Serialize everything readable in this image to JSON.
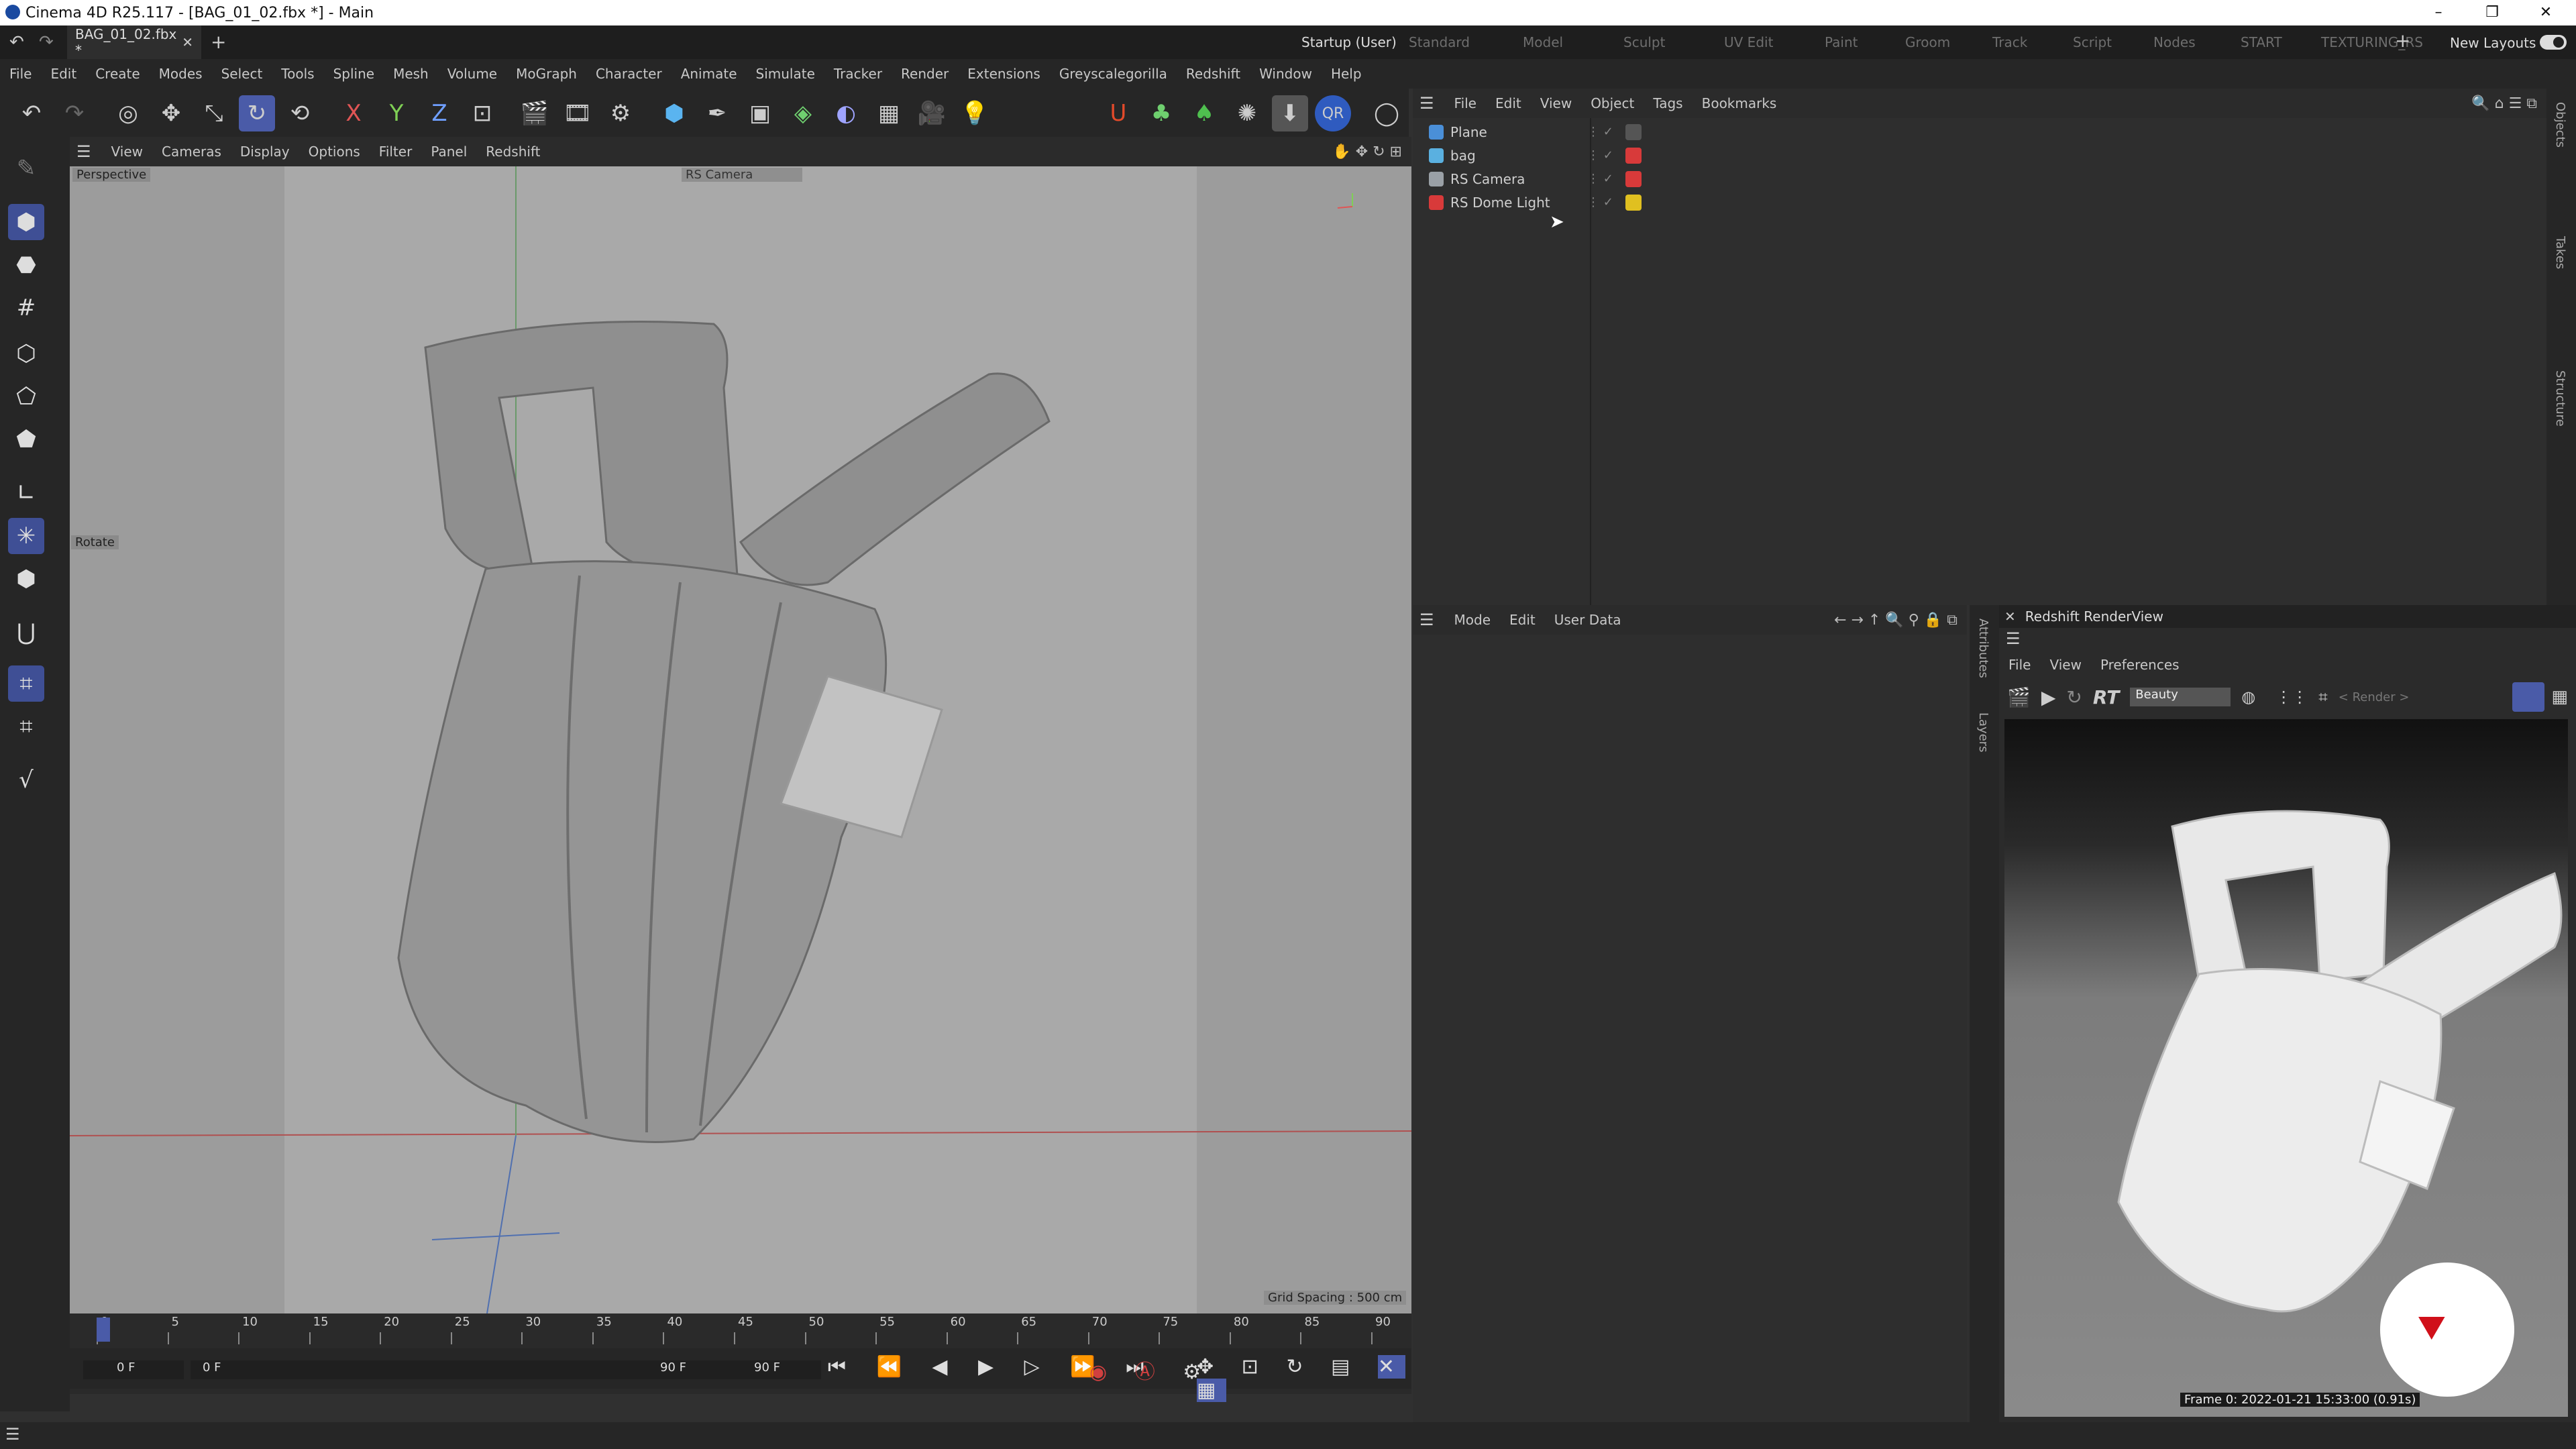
{
  "window": {
    "title": "Cinema 4D R25.117 - [BAG_01_02.fbx *] - Main",
    "min": "–",
    "restore": "❐",
    "close": "✕"
  },
  "tabs": {
    "doc_tab": "BAG_01_02.fbx *",
    "add": "+"
  },
  "layouts": [
    {
      "label": "Startup (User)",
      "active": true
    },
    {
      "label": "Standard"
    },
    {
      "label": "Model"
    },
    {
      "label": "Sculpt"
    },
    {
      "label": "UV Edit"
    },
    {
      "label": "Paint"
    },
    {
      "label": "Groom"
    },
    {
      "label": "Track"
    },
    {
      "label": "Script"
    },
    {
      "label": "Nodes"
    },
    {
      "label": "START"
    },
    {
      "label": "TEXTURING_RS"
    }
  ],
  "layouts_add": "+",
  "new_layouts": "New Layouts",
  "menu": [
    "File",
    "Edit",
    "Create",
    "Modes",
    "Select",
    "Tools",
    "Spline",
    "Mesh",
    "Volume",
    "MoGraph",
    "Character",
    "Animate",
    "Simulate",
    "Tracker",
    "Render",
    "Extensions",
    "Greyscalegorilla",
    "Redshift",
    "Window",
    "Help"
  ],
  "toolbar": {
    "axis_x": "X",
    "axis_y": "Y",
    "axis_z": "Z",
    "qr": "QR"
  },
  "viewport": {
    "menu": [
      "View",
      "Cameras",
      "Display",
      "Options",
      "Filter",
      "Panel",
      "Redshift"
    ],
    "label": "Perspective",
    "camera": "RS Camera",
    "tool_hint": "Rotate",
    "grid_spacing": "Grid Spacing : 500 cm"
  },
  "timeline": {
    "ticks": [
      "0",
      "5",
      "10",
      "15",
      "20",
      "25",
      "30",
      "35",
      "40",
      "45",
      "50",
      "55",
      "60",
      "65",
      "70",
      "75",
      "80",
      "85",
      "90"
    ],
    "current_frame": "0 F",
    "start_frame": "0 F",
    "end_frame": "90 F",
    "end_frame2": "90 F"
  },
  "objects": {
    "menu": [
      "File",
      "Edit",
      "View",
      "Object",
      "Tags",
      "Bookmarks"
    ],
    "items": [
      {
        "name": "Plane",
        "icon": "plane-icon",
        "color": "#4a8fd8"
      },
      {
        "name": "bag",
        "icon": "null-icon",
        "color": "#5ab0e0"
      },
      {
        "name": "RS Camera",
        "icon": "camera-icon",
        "color": "#9aa0a6"
      },
      {
        "name": "RS Dome Light",
        "icon": "dome-light-icon",
        "color": "#d83a3a"
      }
    ]
  },
  "side_tabs": [
    "Objects",
    "Takes",
    "Structure"
  ],
  "attributes": {
    "menu": [
      "Mode",
      "Edit",
      "User Data"
    ],
    "side_tabs": [
      "Attributes",
      "Layers"
    ]
  },
  "render_view": {
    "title": "Redshift RenderView",
    "menu": [
      "File",
      "View",
      "Preferences"
    ],
    "rt": "RT",
    "aov": "Beauty",
    "render_label": "< Render >",
    "frame_info": "Frame 0: 2022-01-21 15:33:00 (0.91s)"
  },
  "colors": {
    "accent": "#4a5ba8",
    "render_logo": "#d0101a"
  }
}
